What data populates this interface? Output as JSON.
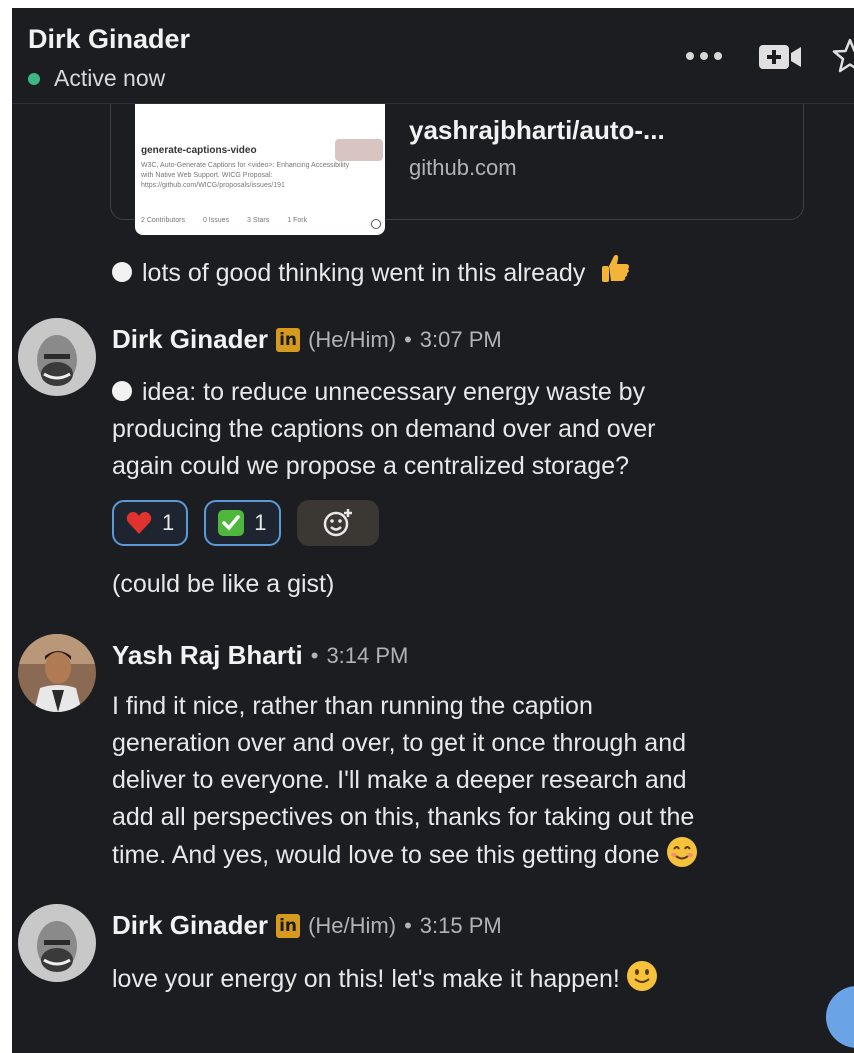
{
  "header": {
    "contact_name": "Dirk Ginader",
    "status": "Active now"
  },
  "link_preview": {
    "title": "yashrajbharti/auto-...",
    "domain": "github.com",
    "thumb": {
      "title": "generate-captions-video",
      "description": "W3C, Auto-Generate Captions for <video>: Enhancing Accessibility with Native Web Support. WICG Proposal: https://github.com/WICG/proposals/issues/191",
      "stats": [
        "2 Contributors",
        "0 Issues",
        "3 Stars",
        "1 Fork"
      ]
    }
  },
  "standalone_message": {
    "text": "lots of good thinking went in this already",
    "emoji": "thumbs-up-emoji"
  },
  "messages": [
    {
      "sender": "Dirk Ginader",
      "pronouns": "(He/Him)",
      "separator": "•",
      "time": "3:07 PM",
      "lines": [
        "idea: to reduce unnecessary energy waste by",
        "producing the captions on demand over and over",
        "again could we propose a centralized storage?"
      ],
      "reactions": [
        {
          "emoji": "heart-emoji",
          "count": "1"
        },
        {
          "emoji": "check-mark-emoji",
          "count": "1"
        }
      ],
      "followup": "(could be like a gist)"
    },
    {
      "sender": "Yash Raj Bharti",
      "separator": "•",
      "time": "3:14 PM",
      "lines": [
        "I find it nice, rather than running the caption",
        "generation over and over, to get it once through and",
        "deliver to everyone. I'll make a deeper research and",
        "add all perspectives on this, thanks for taking out the",
        "time. And yes, would love to see this getting done"
      ]
    },
    {
      "sender": "Dirk Ginader",
      "pronouns": "(He/Him)",
      "separator": "•",
      "time": "3:15 PM",
      "lines": [
        "love your energy on this! let's make it happen!"
      ]
    }
  ],
  "linkedin_badge": "in",
  "colors": {
    "background": "#1b1d21",
    "active_dot": "#3db882",
    "reaction_border": "#5b9ad6",
    "linkedin_badge": "#d69a1e"
  }
}
